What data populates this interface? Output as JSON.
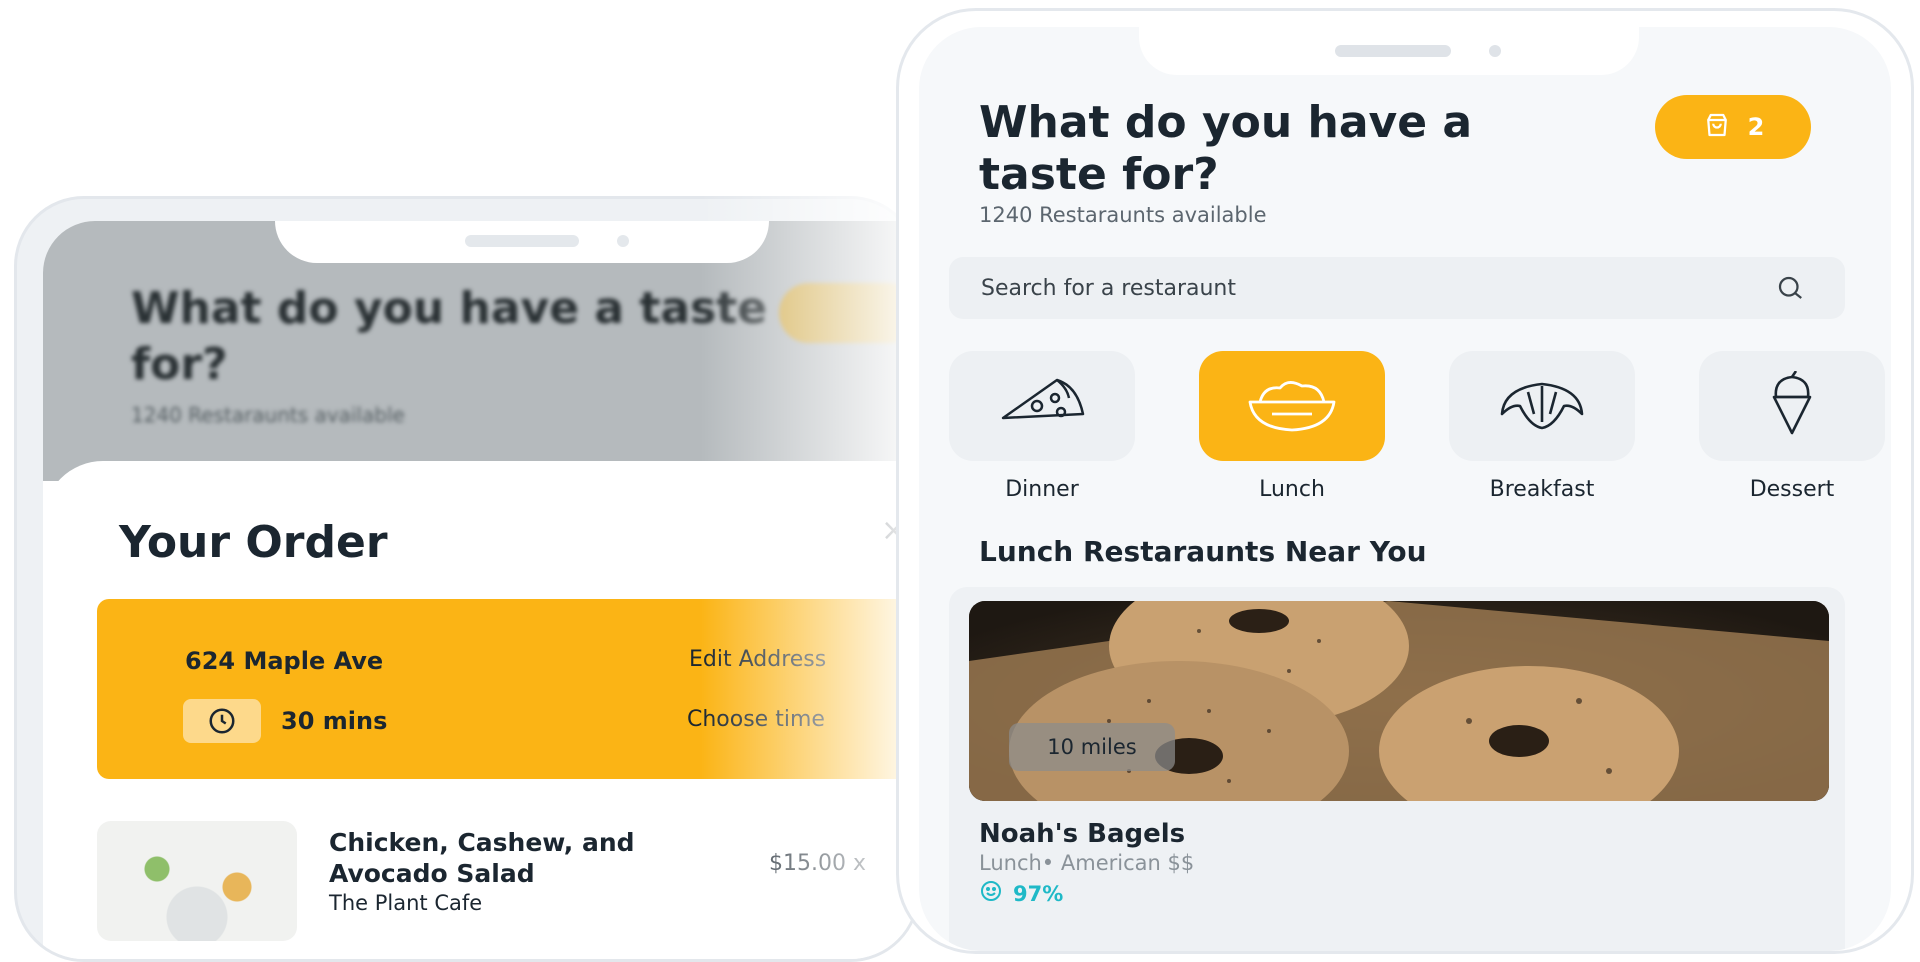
{
  "left_phone": {
    "header_title": "What do you have a taste for?",
    "header_subtitle": "1240 Restaraunts available",
    "order_title": "Your Order",
    "close_label": "×",
    "address": "624 Maple Ave",
    "edit_address_label": "Edit Address",
    "delivery_time": "30 mins",
    "choose_time_label": "Choose time",
    "item": {
      "name": "Chicken, Cashew, and Avocado Salad",
      "restaurant": "The Plant Cafe",
      "price": "$15.00 x"
    }
  },
  "right_phone": {
    "title": "What do you have a taste for?",
    "subtitle": "1240 Restaraunts available",
    "cart": {
      "count": "2",
      "icon": "shopping-bag-icon"
    },
    "search": {
      "placeholder": "Search for a restaraunt",
      "icon": "search-icon"
    },
    "categories": [
      {
        "label": "Dinner",
        "icon": "pizza-icon",
        "active": false
      },
      {
        "label": "Lunch",
        "icon": "bowl-icon",
        "active": true
      },
      {
        "label": "Breakfast",
        "icon": "croissant-icon",
        "active": false
      },
      {
        "label": "Dessert",
        "icon": "ice-cream-icon",
        "active": false
      }
    ],
    "section_title": "Lunch Restaraunts Near You",
    "restaurant": {
      "distance": "10 miles",
      "name": "Noah's Bagels",
      "meta": "Lunch• American $$",
      "rating": "97%",
      "rating_icon": "smiley-icon"
    }
  },
  "colors": {
    "accent": "#fbb415",
    "accent_light": "#fdd98b",
    "rating": "#1fb9c7",
    "text_dark": "#1b2630",
    "tile_bg": "#edf0f3"
  }
}
